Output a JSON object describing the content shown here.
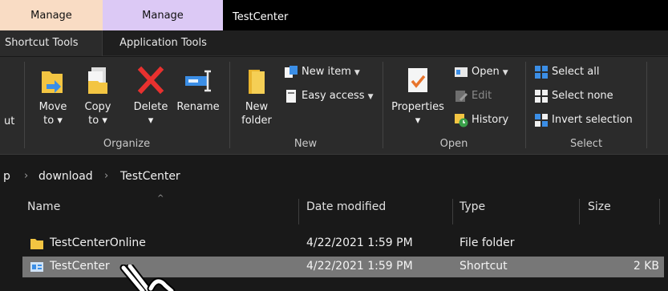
{
  "context_tabs": {
    "manage_shortcut": "Manage",
    "manage_application": "Manage",
    "window_title": "TestCenter"
  },
  "ribbon_tabs": {
    "shortcut_tools": "Shortcut Tools",
    "application_tools": "Application Tools"
  },
  "ribbon": {
    "cut_fragment": "ut",
    "organize": {
      "label": "Organize",
      "move_to": "Move\nto ▾",
      "copy_to": "Copy\nto ▾",
      "delete": "Delete\n▾",
      "rename": "Rename"
    },
    "new": {
      "label": "New",
      "new_folder": "New\nfolder",
      "new_item": "New item",
      "easy_access": "Easy access"
    },
    "open": {
      "label": "Open",
      "properties": "Properties\n▾",
      "open": "Open",
      "edit": "Edit",
      "history": "History"
    },
    "select": {
      "label": "Select",
      "select_all": "Select all",
      "select_none": "Select none",
      "invert_selection": "Invert selection"
    }
  },
  "address_bar": {
    "fragment": "p",
    "crumbs": [
      "download",
      "TestCenter"
    ]
  },
  "columns": {
    "name": "Name",
    "date_modified": "Date modified",
    "type": "Type",
    "size": "Size"
  },
  "files": [
    {
      "name": "TestCenterOnline",
      "date": "4/22/2021 1:59 PM",
      "type": "File folder",
      "size": "",
      "icon": "folder-icon"
    },
    {
      "name": "TestCenter",
      "date": "4/22/2021 1:59 PM",
      "type": "Shortcut",
      "size": "2 KB",
      "icon": "shortcut-app-icon"
    }
  ],
  "colors": {
    "manage_shortcut_bg": "#f9dcc4",
    "manage_application_bg": "#dcc9f5",
    "ribbon_bg": "#2b2b2b",
    "window_bg": "#191919",
    "selected_row": "#777777",
    "accent_blue": "#3b8ee6"
  }
}
